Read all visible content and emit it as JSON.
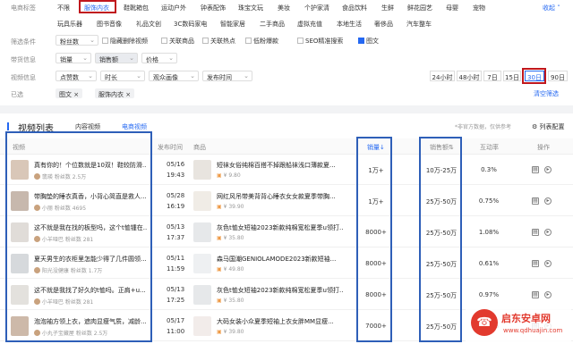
{
  "filters": {
    "category_label": "电商标签",
    "categories_row1": [
      "不限",
      "服饰内衣",
      "鞋靴箱包",
      "运动户外",
      "钟表配饰",
      "珠宝文玩",
      "美妆",
      "个护家清",
      "食品饮料",
      "生鲜",
      "鲜花园艺",
      "母婴",
      "宠物"
    ],
    "collapse_label": "收起",
    "categories_row2": [
      "玩具乐器",
      "图书音像",
      "礼品文创",
      "3C数码家电",
      "智能家居",
      "二手商品",
      "虚拟充值",
      "本地生活",
      "奢侈品",
      "汽车整车"
    ],
    "conditions_label": "筛选条件",
    "fans_dropdown": "粉丝数",
    "checks": [
      {
        "label": "隐藏删除视频",
        "on": false
      },
      {
        "label": "关联商品",
        "on": false
      },
      {
        "label": "关联热点",
        "on": false
      },
      {
        "label": "低粉爆款",
        "on": false
      },
      {
        "label": "SEO精准搜索",
        "on": false
      },
      {
        "label": "图文",
        "on": true
      }
    ],
    "goods_label": "带货信息",
    "goods_dropdowns": [
      "销量",
      "销售额",
      "价格"
    ],
    "video_label": "视频信息",
    "video_dropdowns": [
      "点赞数",
      "时长",
      "观众画像",
      "发布时间"
    ],
    "time_ranges": [
      "24小时",
      "48小时",
      "7日",
      "15日",
      "30日",
      "90日"
    ],
    "selected_label": "已选",
    "selected_chips": [
      "图文",
      "服饰内衣"
    ],
    "clear_label": "清空筛选"
  },
  "list": {
    "title": "视频列表",
    "tabs": [
      "内容视频",
      "电商视频"
    ],
    "notice": "*非官方数据，仅供参考",
    "config_label": "列表配置",
    "headers": {
      "video": "视频",
      "time": "发布时间",
      "goods": "商品",
      "sales": "销量",
      "amount": "销售额",
      "engage": "互动率",
      "op": "操作"
    },
    "rows": [
      {
        "title": "真有你的！个位数就是10双！鞋较防滑...",
        "author": "翡瑛",
        "fans": "粉丝数 2.5万",
        "date": "05/16",
        "time": "19:43",
        "goods": "短袜女俗纯棉百搭不掉跟船袜浅口薄款夏...",
        "price": "¥ 9.80",
        "sales": "1万+",
        "amount": "10万-25万",
        "rate": "0.3%"
      },
      {
        "title": "带胸垫的睡衣真香，小背心简直是救人...",
        "author": "小丽",
        "fans": "粉丝数 4695",
        "date": "05/28",
        "time": "16:19",
        "goods": "网红风吊带美背背心睡衣女女款夏季带胸...",
        "price": "¥ 39.90",
        "sales": "1万+",
        "amount": "25万-50万",
        "rate": "0.75%"
      },
      {
        "title": "这不就是我在找的板型吗，这个t恤锺在...",
        "author": "小羊哑巴",
        "fans": "粉丝数 281",
        "date": "05/13",
        "time": "17:37",
        "goods": "灰色t恤女短袖2023新款纯棉宽松夏季u领打...",
        "price": "¥ 35.80",
        "sales": "8000+",
        "amount": "25万-50万",
        "rate": "1.08%"
      },
      {
        "title": "夏天男生的衣柜里怎能少得了几件圆领...",
        "author": "阳光没健康",
        "fans": "粉丝数 1.7万",
        "date": "05/11",
        "time": "11:59",
        "goods": "森马国潮GENIOLAMODE2023新款短袖...",
        "price": "¥ 49.80",
        "sales": "8000+",
        "amount": "25万-50万",
        "rate": "0.61%"
      },
      {
        "title": "这不就是我找了好久的t恤吗。正肩+u...",
        "author": "小羊哑巴",
        "fans": "粉丝数 281",
        "date": "05/13",
        "time": "17:25",
        "goods": "灰色t恤女短袖2023新款纯棉宽松夏季u领打...",
        "price": "¥ 35.80",
        "sales": "8000+",
        "amount": "25万-50万",
        "rate": "0.97%"
      },
      {
        "title": "泡泡袖方领上衣，遮肉显瘦气质，减龄...",
        "author": "小丸子宝藏屋",
        "fans": "粉丝数 2.5万",
        "date": "05/17",
        "time": "11:00",
        "goods": "大码女装小众夏季短袖上衣女胖MM显瘦...",
        "price": "¥ 39.80",
        "sales": "7000+",
        "amount": "25万-50万",
        "rate": "1.86%"
      }
    ]
  },
  "colors": {
    "accent": "#2468f2",
    "red_box": "#c0171d",
    "blue_box": "#2e5fb8"
  }
}
